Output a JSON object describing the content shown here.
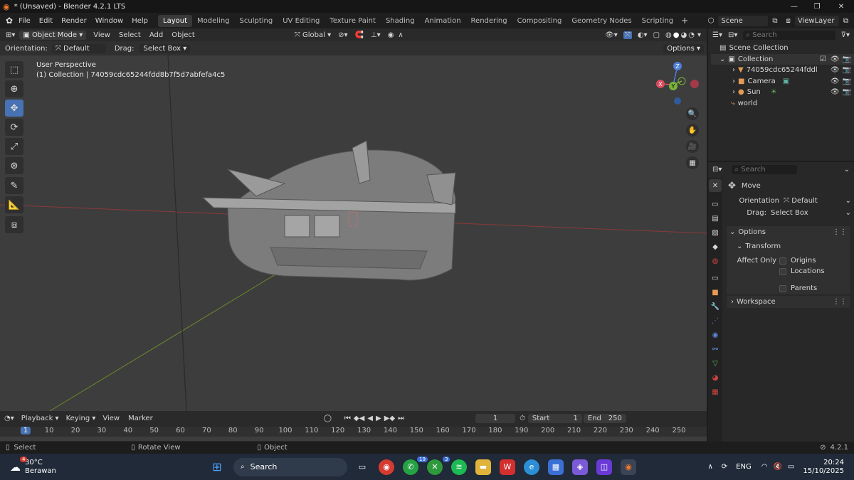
{
  "titlebar": {
    "title": "* (Unsaved) - Blender 4.2.1 LTS"
  },
  "menu": {
    "items": [
      "File",
      "Edit",
      "Render",
      "Window",
      "Help"
    ]
  },
  "workspaces": [
    "Layout",
    "Modeling",
    "Sculpting",
    "UV Editing",
    "Texture Paint",
    "Shading",
    "Animation",
    "Rendering",
    "Compositing",
    "Geometry Nodes",
    "Scripting"
  ],
  "scene": {
    "name": "Scene",
    "view_layer": "ViewLayer"
  },
  "viewport_header": {
    "mode": "Object Mode",
    "menus": [
      "View",
      "Select",
      "Add",
      "Object"
    ],
    "transform": "Global"
  },
  "tool_header": {
    "orientation_label": "Orientation:",
    "orientation_value": "Default",
    "drag_label": "Drag:",
    "drag_value": "Select Box",
    "options": "Options"
  },
  "viewport": {
    "perspective": "User Perspective",
    "collection_info": "(1) Collection | 74059cdc65244fdd8b7f5d7abfefa4c5"
  },
  "gizmo": {
    "z": "Z",
    "y": "Y",
    "x": "X"
  },
  "outliner": {
    "search_placeholder": "Search",
    "scene_collection": "Scene Collection",
    "collection": "Collection",
    "items": [
      "74059cdc65244fddl",
      "Camera",
      "Sun"
    ],
    "world": "world"
  },
  "properties": {
    "search_placeholder": "Search",
    "tool_name": "Move",
    "orientation_label": "Orientation",
    "orientation_value": "Default",
    "drag_label": "Drag:",
    "drag_value": "Select Box",
    "options_panel": "Options",
    "transform_panel": "Transform",
    "affect_only": "Affect Only",
    "checks": [
      "Origins",
      "Locations",
      "Parents"
    ],
    "workspace_panel": "Workspace"
  },
  "timeline": {
    "menus": [
      "Playback",
      "Keying",
      "View",
      "Marker"
    ],
    "current_frame": "1",
    "start_label": "Start",
    "start": "1",
    "end_label": "End",
    "end": "250",
    "ruler": [
      "1",
      "10",
      "20",
      "30",
      "40",
      "50",
      "60",
      "70",
      "80",
      "90",
      "100",
      "110",
      "120",
      "130",
      "140",
      "150",
      "160",
      "170",
      "180",
      "190",
      "200",
      "210",
      "220",
      "230",
      "240",
      "250"
    ]
  },
  "statusbar": {
    "select": "Select",
    "rotate": "Rotate View",
    "object": "Object",
    "version": "4.2.1"
  },
  "taskbar": {
    "temp": "30°C",
    "weather": "Berawan",
    "weather_badge": "4",
    "search": "Search",
    "lang": "ENG",
    "time": "20:24",
    "date": "15/10/2025",
    "whatsapp_badge": "19",
    "xbox_badge": "3"
  }
}
